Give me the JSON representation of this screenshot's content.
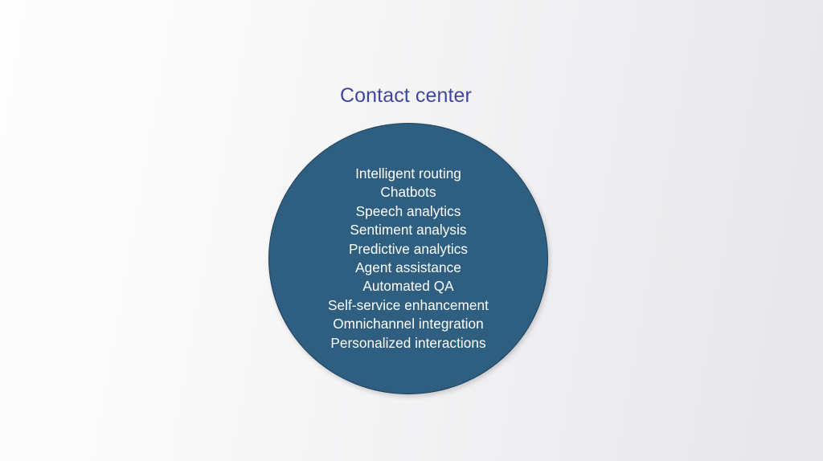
{
  "slide": {
    "background_left_color": "#fdfdfe",
    "background_right_color": "#e7e7e9",
    "title": "Contact center",
    "title_color": "#3f46a0"
  },
  "circle": {
    "fill_color": "#2e5e80",
    "border_color": "#1d3f5b",
    "text_color": "#ffffff",
    "items": [
      {
        "label": "Intelligent routing"
      },
      {
        "label": "Chatbots"
      },
      {
        "label": "Speech analytics"
      },
      {
        "label": "Sentiment analysis"
      },
      {
        "label": "Predictive analytics"
      },
      {
        "label": "Agent assistance"
      },
      {
        "label": "Automated QA"
      },
      {
        "label": "Self-service enhancement"
      },
      {
        "label": "Omnichannel integration"
      },
      {
        "label": "Personalized interactions"
      }
    ]
  }
}
